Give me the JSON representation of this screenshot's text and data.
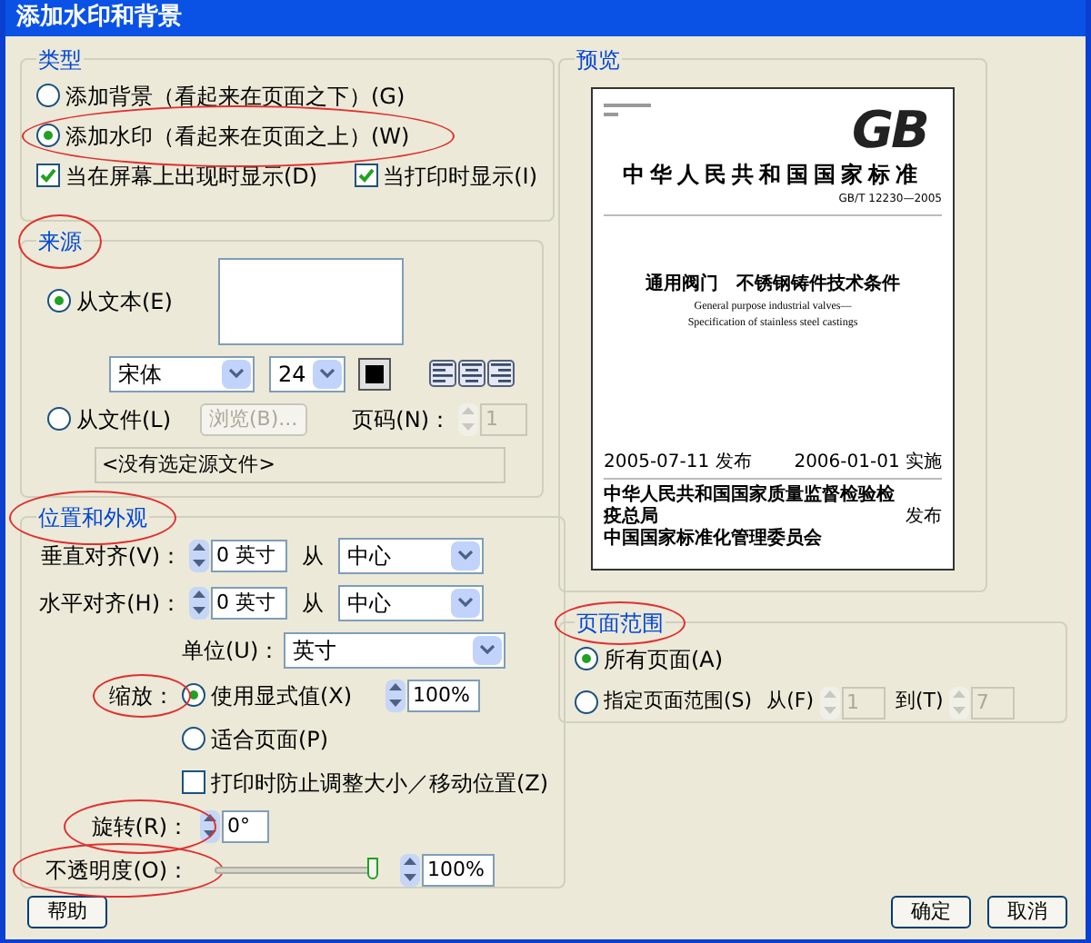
{
  "window": {
    "title": "添加水印和背景"
  },
  "type_group": {
    "title": "类型",
    "options": [
      {
        "label": "添加背景（看起来在页面之下）(G)",
        "selected": false
      },
      {
        "label": "添加水印（看起来在页面之上）(W)",
        "selected": true
      }
    ],
    "checkboxes": [
      {
        "label": "当在屏幕上出现时显示(D)",
        "checked": true
      },
      {
        "label": "当打印时显示(I)",
        "checked": true
      }
    ]
  },
  "source_group": {
    "title": "来源",
    "from_text": {
      "label": "从文本(E)",
      "selected": true
    },
    "font": "宋体",
    "font_size": "24",
    "align_buttons": [
      {
        "kind": "left"
      },
      {
        "kind": "center"
      },
      {
        "kind": "right"
      }
    ],
    "from_file": {
      "label": "从文件(L)",
      "selected": false
    },
    "browse_button": {
      "label": "浏览(B)...",
      "disabled": true
    },
    "page_label": "页码(N)：",
    "page_value": "1",
    "file_field": "<没有选定源文件>"
  },
  "position_group": {
    "title": "位置和外观",
    "vertical": {
      "label": "垂直对齐(V)：",
      "value": "0 英寸",
      "from": "从",
      "anchor": "中心"
    },
    "horizontal": {
      "label": "水平对齐(H)：",
      "value": "0 英寸",
      "from": "从",
      "anchor": "中心"
    },
    "unit": {
      "label": "单位(U)：",
      "value": "英寸"
    },
    "scale_label": "缩放：",
    "scale_options": [
      {
        "label": "使用显式值(X)",
        "selected": true,
        "value": "100%"
      },
      {
        "label": "适合页面(P)",
        "selected": false
      }
    ],
    "prevent_resize": {
      "label": "打印时防止调整大小／移动位置(Z)",
      "checked": false
    },
    "rotation": {
      "label": "旋转(R)：",
      "value": "0°"
    },
    "opacity": {
      "label": "不透明度(O)：",
      "level": 1,
      "value": "100%"
    }
  },
  "preview": {
    "title": "预览",
    "page": {
      "logo": "GB",
      "heading": "中华人民共和国国家标准",
      "code": "GB/T 12230—2005",
      "title": "通用阀门　不锈钢铸件技术条件",
      "subtitle_lines": [
        "General purpose industrial valves—",
        "Specification of stainless steel castings"
      ],
      "issued": "2005-07-11 发布",
      "effective": "2006-01-01 实施",
      "issuers": [
        "中华人民共和国国家质量监督检验检疫总局",
        "中国国家标准化管理委员会"
      ],
      "issued_by": "发布"
    }
  },
  "page_range": {
    "title": "页面范围",
    "options": [
      {
        "label": "所有页面(A)",
        "selected": true
      },
      {
        "label": "指定页面范围(S)",
        "selected": false
      }
    ],
    "from_label": "从(F)",
    "from_value": "1",
    "to_label": "到(T)",
    "to_value": "7",
    "disabled": true
  },
  "buttons": {
    "help": "帮助",
    "ok": "确定",
    "cancel": "取消"
  }
}
